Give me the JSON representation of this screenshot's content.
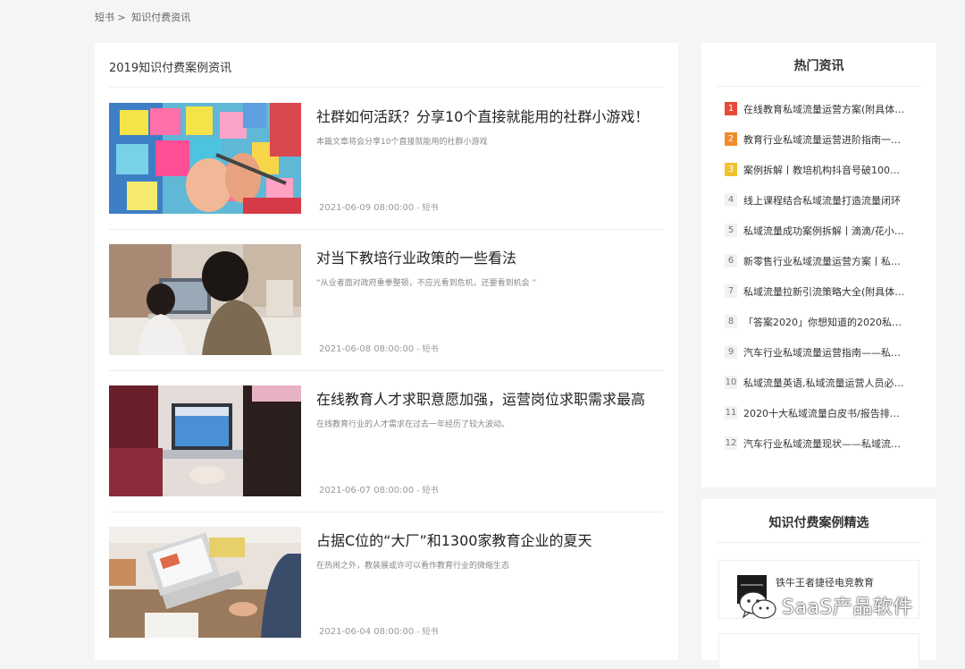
{
  "breadcrumb": {
    "home": "短书",
    "separator": ">",
    "current": "知识付费资讯"
  },
  "main": {
    "title": "2019知识付费案例资讯",
    "articles": [
      {
        "title": "社群如何活跃？分享10个直接就能用的社群小游戏！",
        "desc": "本篇文章将会分享10个直接就能用的社群小游戏",
        "date": "2021-06-09 08:00:00",
        "source": "- 短书"
      },
      {
        "title": "对当下教培行业政策的一些看法",
        "desc": "“从业者面对政府重拳整顿，不应光看到危机，还要看到机会 ”",
        "date": "2021-06-08 08:00:00",
        "source": "- 短书"
      },
      {
        "title": "在线教育人才求职意愿加强，运营岗位求职需求最高",
        "desc": "在线教育行业的人才需求在过去一年经历了较大波动。",
        "date": "2021-06-07 08:00:00",
        "source": "- 短书"
      },
      {
        "title": "占据C位的“大厂”和1300家教育企业的夏天",
        "desc": "在热闹之外，教装展或许可以看作教育行业的微缩生态",
        "date": "2021-06-04 08:00:00",
        "source": "- 短书"
      }
    ]
  },
  "hot": {
    "title": "热门资讯",
    "items": [
      {
        "rank": "1",
        "text": "在线教育私域流量运营方案(附具体…"
      },
      {
        "rank": "2",
        "text": "教育行业私域流量运营进阶指南一…"
      },
      {
        "rank": "3",
        "text": "案例拆解丨教培机构抖音号破100…"
      },
      {
        "rank": "4",
        "text": "线上课程结合私域流量打造流量闭环"
      },
      {
        "rank": "5",
        "text": "私域流量成功案例拆解丨滴滴/花小…"
      },
      {
        "rank": "6",
        "text": "新零售行业私域流量运营方案丨私…"
      },
      {
        "rank": "7",
        "text": "私域流量拉新引流策略大全(附具体…"
      },
      {
        "rank": "8",
        "text": "「答案2020」你想知道的2020私…"
      },
      {
        "rank": "9",
        "text": "汽车行业私域流量运营指南——私…"
      },
      {
        "rank": "10",
        "text": "私域流量英语,私域流量运营人员必…"
      },
      {
        "rank": "11",
        "text": "2020十大私域流量白皮书/报告排…"
      },
      {
        "rank": "12",
        "text": "汽车行业私域流量现状——私域流…"
      }
    ],
    "rank_colors": [
      "#e84a3a",
      "#f08a2e",
      "#f2c12e"
    ]
  },
  "cases": {
    "title": "知识付费案例精选",
    "items": [
      {
        "name": "铁牛王者捷径电竞教育"
      }
    ]
  },
  "watermark": {
    "text": "SaaS产品软件"
  }
}
